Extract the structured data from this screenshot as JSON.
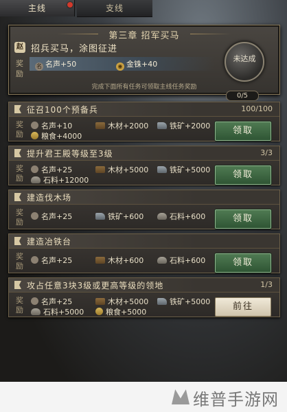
{
  "tabs": {
    "main": "主线",
    "side": "支线"
  },
  "chapter": {
    "title": "第三章 招军买马",
    "mission_badge": "赵",
    "mission": "招兵买马，涂图征进",
    "reward_label": "奖励",
    "rewards": [
      {
        "icon": "fame-icon",
        "text": "名声+50"
      },
      {
        "icon": "gold-icon",
        "text": "金铢+40"
      }
    ],
    "footer": "完成下面所有任务可领取主线任务奖励",
    "status": "未达成",
    "progress": "0/5"
  },
  "tasks": [
    {
      "title": "征召100个预备兵",
      "progress": "100/100",
      "reward_label": "奖励",
      "rewards_row1": [
        {
          "icon": "fame-icon",
          "text": "名声+10"
        },
        {
          "icon": "wood-icon",
          "text": "木材+2000"
        },
        {
          "icon": "iron-icon",
          "text": "铁矿+2000"
        }
      ],
      "rewards_row2": [
        {
          "icon": "food-icon",
          "text": "粮食+4000"
        }
      ],
      "button": "领取",
      "button_type": "claim"
    },
    {
      "title": "提升君王殿等级至3级",
      "progress": "3/3",
      "reward_label": "奖励",
      "rewards_row1": [
        {
          "icon": "fame-icon",
          "text": "名声+25"
        },
        {
          "icon": "wood-icon",
          "text": "木材+5000"
        },
        {
          "icon": "iron-icon",
          "text": "铁矿+5000"
        }
      ],
      "rewards_row2": [
        {
          "icon": "stone-icon",
          "text": "石料+12000"
        }
      ],
      "button": "领取",
      "button_type": "claim"
    },
    {
      "title": "建造伐木场",
      "progress": "",
      "reward_label": "奖励",
      "rewards_row1": [
        {
          "icon": "fame-icon",
          "text": "名声+25"
        },
        {
          "icon": "iron-icon",
          "text": "铁矿+600"
        },
        {
          "icon": "stone-icon",
          "text": "石料+600"
        }
      ],
      "rewards_row2": [],
      "button": "领取",
      "button_type": "claim"
    },
    {
      "title": "建造冶铁台",
      "progress": "",
      "reward_label": "奖励",
      "rewards_row1": [
        {
          "icon": "fame-icon",
          "text": "名声+25"
        },
        {
          "icon": "wood-icon",
          "text": "木材+600"
        },
        {
          "icon": "stone-icon",
          "text": "石料+600"
        }
      ],
      "rewards_row2": [],
      "button": "领取",
      "button_type": "claim"
    },
    {
      "title": "攻占任意3块3级或更高等级的领地",
      "progress": "1/3",
      "reward_label": "奖励",
      "rewards_row1": [
        {
          "icon": "fame-icon",
          "text": "名声+25"
        },
        {
          "icon": "wood-icon",
          "text": "木材+5000"
        },
        {
          "icon": "iron-icon",
          "text": "铁矿+5000"
        }
      ],
      "rewards_row2": [
        {
          "icon": "stone-icon",
          "text": "石料+5000"
        },
        {
          "icon": "food-icon",
          "text": "粮食+5000"
        }
      ],
      "button": "前往",
      "button_type": "go"
    }
  ],
  "watermark": "维普手游网"
}
